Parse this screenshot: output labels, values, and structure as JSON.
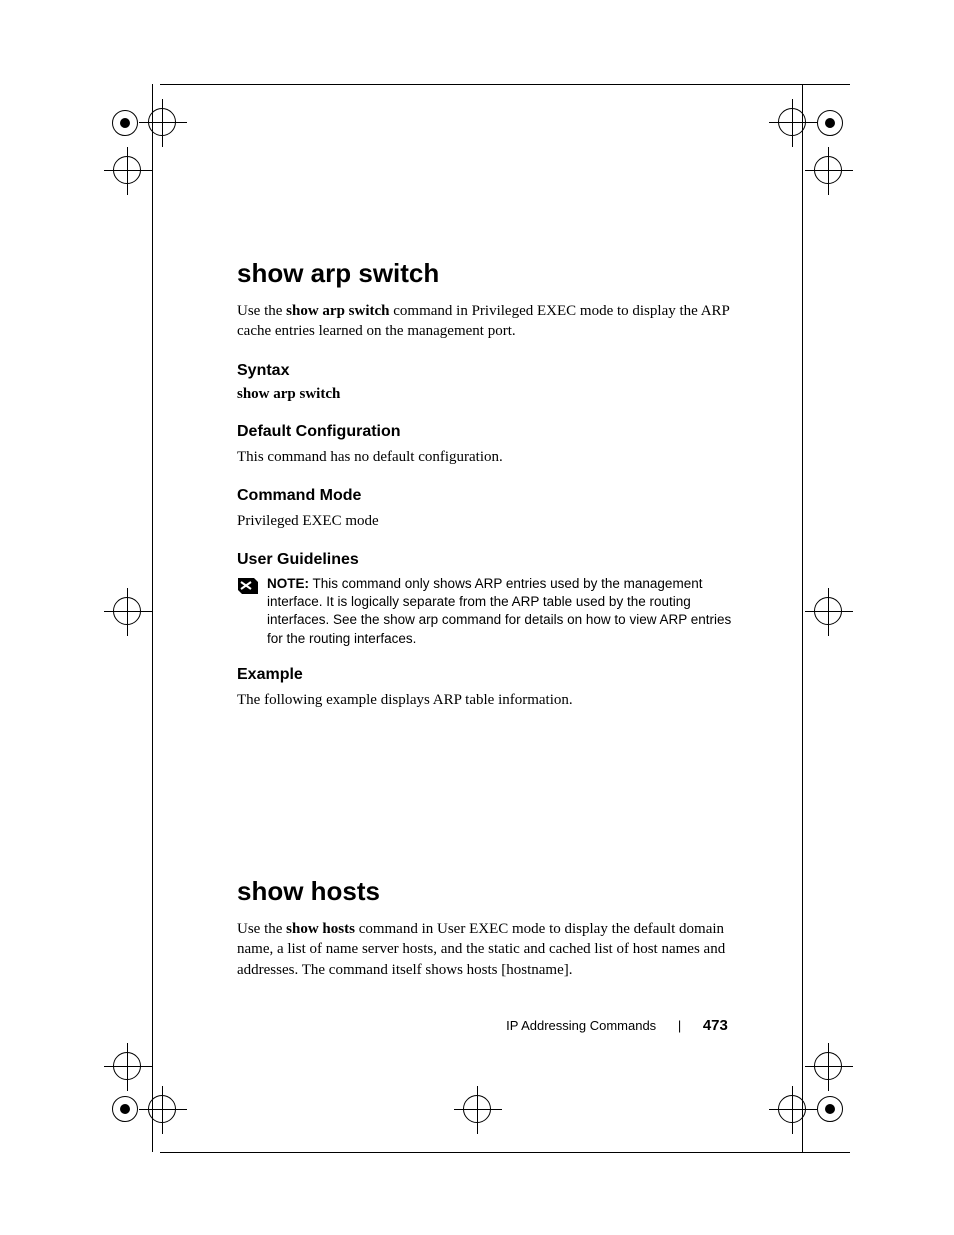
{
  "section1": {
    "title": "show arp switch",
    "intro_pre": "Use the ",
    "intro_cmd": "show arp switch",
    "intro_post": " command in Privileged EXEC mode to display the ARP cache entries learned on the management port.",
    "syntax_heading": "Syntax",
    "syntax_cmd": "show arp switch",
    "default_config_heading": "Default Configuration",
    "default_config_text": "This command has no default configuration.",
    "command_mode_heading": "Command Mode",
    "command_mode_text": "Privileged EXEC mode",
    "user_guidelines_heading": "User Guidelines",
    "note_prefix": "NOTE:",
    "note_text": " This command only shows ARP entries used by the management interface. It is logically separate from the ARP table used by the routing interfaces. See the show arp command for details on how to view ARP entries for the routing interfaces.",
    "example_heading": "Example",
    "example_text": "The following example displays ARP table information."
  },
  "section2": {
    "title": "show hosts",
    "intro_pre": "Use the ",
    "intro_cmd": "show hosts",
    "intro_post": " command in User EXEC mode to display the default domain name, a list of name server hosts, and the static and cached list of host names and addresses. The command itself shows hosts [hostname]."
  },
  "footer": {
    "section_label": "IP Addressing Commands",
    "page_number": "473"
  }
}
